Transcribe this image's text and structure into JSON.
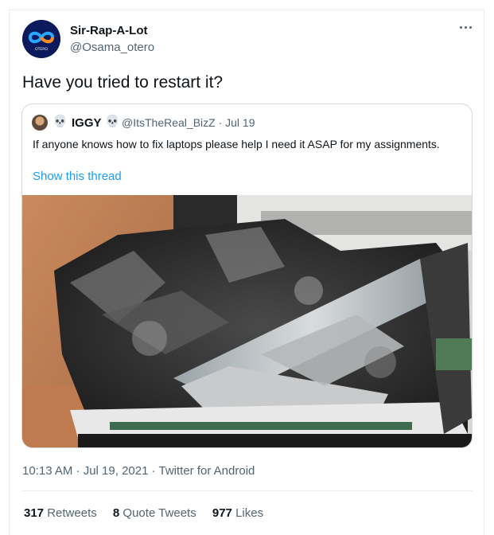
{
  "author": {
    "name": "Sir-Rap-A-Lot",
    "handle": "@Osama_otero",
    "avatar_text": "OTERO"
  },
  "tweet": {
    "text": "Have you tried to restart it?"
  },
  "quoted": {
    "skull_left": "💀",
    "name": "IGGY",
    "skull_right": "💀",
    "handle_date": "@ItsTheReal_BizZ · Jul 19",
    "text": "If anyone knows how to fix laptops please  help I need it ASAP for my assignments.",
    "link": "Show this thread"
  },
  "meta": {
    "timestamp": "10:13 AM · Jul 19, 2021 · Twitter for Android"
  },
  "stats": {
    "retweets_count": "317",
    "retweets_label": "Retweets",
    "quotes_count": "8",
    "quotes_label": "Quote Tweets",
    "likes_count": "977",
    "likes_label": "Likes"
  },
  "colors": {
    "link": "#1d9bf0",
    "secondary_text": "#536471",
    "border": "#cfd9de"
  }
}
